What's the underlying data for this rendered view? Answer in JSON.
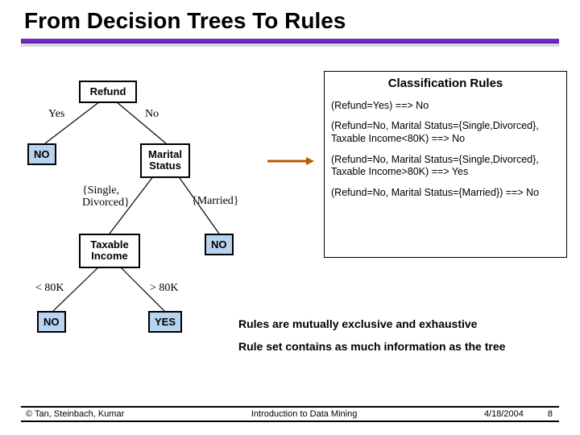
{
  "title": "From Decision Trees To Rules",
  "tree": {
    "nodes": {
      "refund": "Refund",
      "marital": "Marital\nStatus",
      "taxable": "Taxable\nIncome"
    },
    "leaves": {
      "no1": "NO",
      "no2": "NO",
      "no3": "NO",
      "yes": "YES"
    },
    "edges": {
      "refund_yes": "Yes",
      "refund_no": "No",
      "marital_single": "{Single,\nDivorced}",
      "marital_married": "{Married}",
      "income_lt": "< 80K",
      "income_gt": "> 80K"
    }
  },
  "rules_panel": {
    "title": "Classification Rules",
    "rules": [
      "(Refund=Yes) ==> No",
      "(Refund=No, Marital Status={Single,Divorced}, Taxable Income<80K) ==> No",
      "(Refund=No, Marital Status={Single,Divorced}, Taxable Income>80K) ==> Yes",
      "(Refund=No, Marital Status={Married}) ==> No"
    ]
  },
  "notes": {
    "line1": "Rules are mutually exclusive and exhaustive",
    "line2": "Rule set contains as much information as the tree"
  },
  "footer": {
    "authors": "© Tan, Steinbach, Kumar",
    "course": "Introduction to Data Mining",
    "date": "4/18/2004",
    "page": "8"
  }
}
